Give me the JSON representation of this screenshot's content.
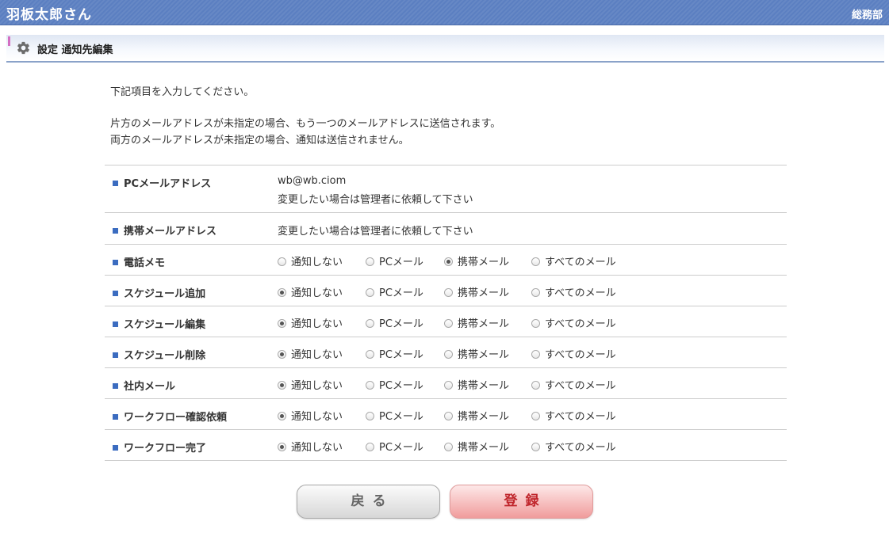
{
  "header": {
    "user_name": "羽板太郎さん",
    "department": "総務部"
  },
  "section": {
    "title": "設定 通知先編集"
  },
  "intro": {
    "line1": "下記項目を入力してください。",
    "line2": "片方のメールアドレスが未指定の場合、もう一つのメールアドレスに送信されます。",
    "line3": "両方のメールアドレスが未指定の場合、通知は送信されません。"
  },
  "fields": {
    "pc_mail": {
      "label": "PCメールアドレス",
      "value": "wb@wb.ciom",
      "note": "変更したい場合は管理者に依頼して下さい"
    },
    "mobile_mail": {
      "label": "携帯メールアドレス",
      "note": "変更したい場合は管理者に依頼して下さい"
    }
  },
  "options": [
    "通知しない",
    "PCメール",
    "携帯メール",
    "すべてのメール"
  ],
  "notifications": [
    {
      "label": "電話メモ",
      "selected": 2
    },
    {
      "label": "スケジュール追加",
      "selected": 0
    },
    {
      "label": "スケジュール編集",
      "selected": 0
    },
    {
      "label": "スケジュール削除",
      "selected": 0
    },
    {
      "label": "社内メール",
      "selected": 0
    },
    {
      "label": "ワークフロー確認依頼",
      "selected": 0
    },
    {
      "label": "ワークフロー完了",
      "selected": 0
    }
  ],
  "buttons": {
    "back": "戻る",
    "register": "登録"
  },
  "colors": {
    "header_bar": "#5b7fc1",
    "label_marker": "#3b6cc0",
    "register_text": "#c0262c"
  }
}
